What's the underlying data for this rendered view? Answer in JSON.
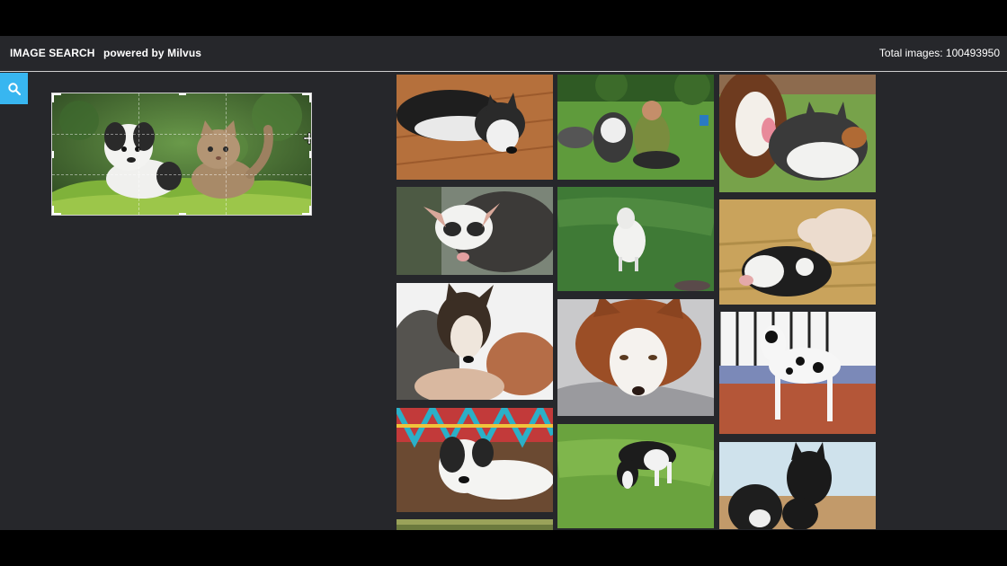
{
  "header": {
    "title": "IMAGE SEARCH",
    "subtitle": "powered by Milvus",
    "total_label": "Total images: 100493950"
  },
  "search": {
    "icon": "search-icon"
  },
  "query_image": {
    "subject": "puppy and kitten on grass"
  },
  "results": [
    {
      "subject": "husky lying on wood floor"
    },
    {
      "subject": "man with husky on lawn"
    },
    {
      "subject": "two huskies"
    },
    {
      "subject": "opossum"
    },
    {
      "subject": "white goat in grass"
    },
    {
      "subject": "calves in straw"
    },
    {
      "subject": "dog close-up on lap"
    },
    {
      "subject": "red husky resting on bed"
    },
    {
      "subject": "great dane puppy on tiles"
    },
    {
      "subject": "dog on colorful rug"
    },
    {
      "subject": "border collie sniffing grass"
    },
    {
      "subject": "two dark dogs outdoors"
    },
    {
      "subject": "partial image"
    }
  ],
  "colors": {
    "accent": "#38b6f0",
    "background": "#26272b"
  }
}
